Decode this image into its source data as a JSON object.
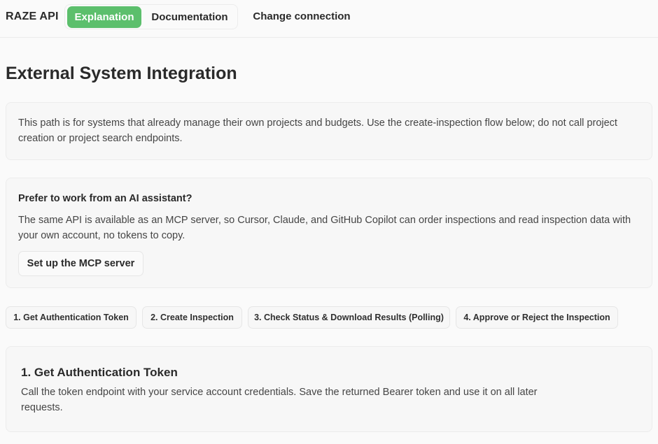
{
  "app": {
    "brand": "RAZE API"
  },
  "nav": {
    "tabs": [
      {
        "label": "Explanation",
        "active": true
      },
      {
        "label": "Documentation",
        "active": false
      }
    ],
    "change_connection": "Change connection"
  },
  "page": {
    "title": "External System Integration"
  },
  "intro": {
    "text": "This path is for systems that already manage their own projects and budgets. Use the create-inspection flow below; do not call project creation or project search endpoints."
  },
  "mcp": {
    "heading": "Prefer to work from an AI assistant?",
    "text": "The same API is available as an MCP server, so Cursor, Claude, and GitHub Copilot can order inspections and read inspection data with your own account, no tokens to copy.",
    "button": "Set up the MCP server"
  },
  "steps": [
    {
      "label": "1. Get Authentication Token"
    },
    {
      "label": "2. Create Inspection"
    },
    {
      "label": "3. Check Status & Download Results (Polling)"
    },
    {
      "label": "4. Approve or Reject the Inspection"
    }
  ],
  "section": {
    "title": "1. Get Authentication Token",
    "text": "Call the token endpoint with your service account credentials. Save the returned Bearer token and use it on all later requests."
  },
  "colors": {
    "accent": "#5cbf6c",
    "background": "#fafafa",
    "card": "#f7f7f7",
    "border": "#ececec"
  }
}
